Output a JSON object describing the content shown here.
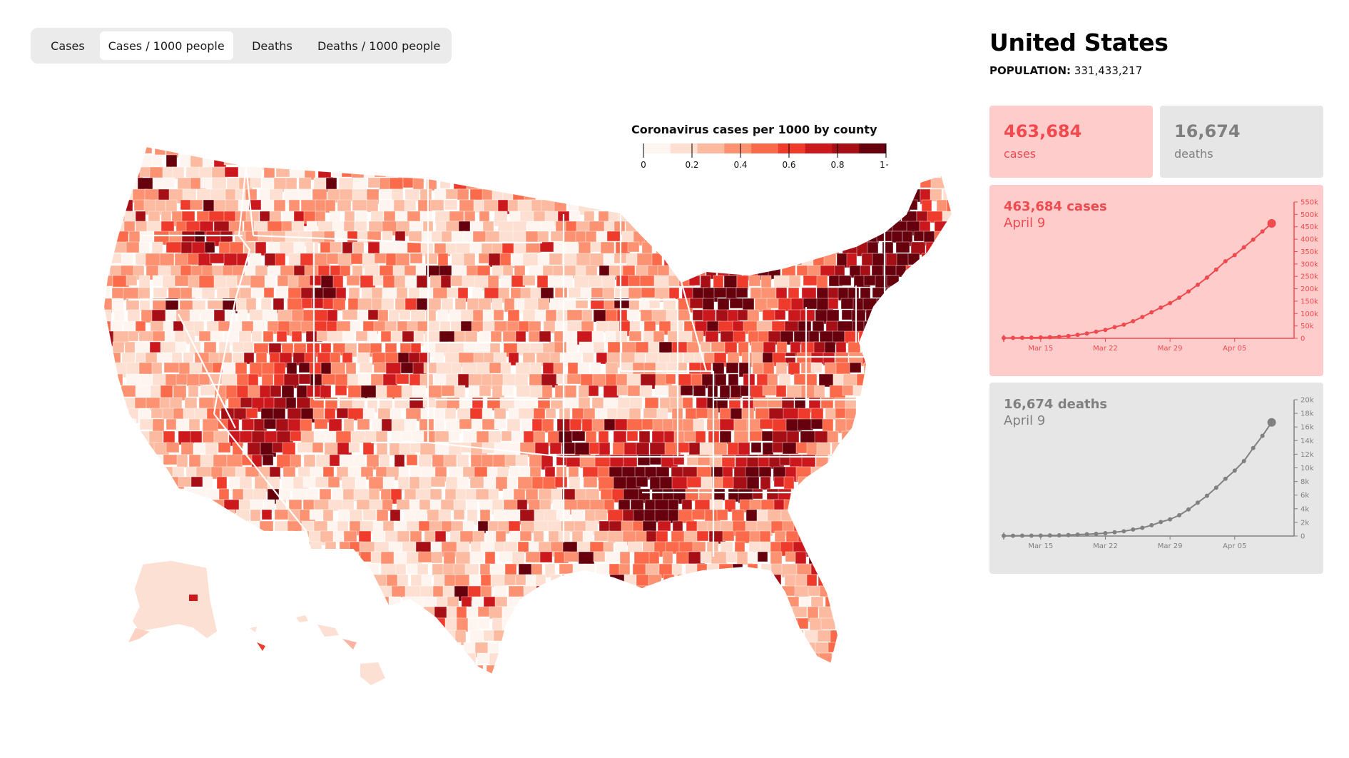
{
  "tabs": [
    {
      "label": "Cases",
      "active": false
    },
    {
      "label": "Cases / 1000 people",
      "active": true
    },
    {
      "label": "Deaths",
      "active": false
    },
    {
      "label": "Deaths / 1000 people",
      "active": false
    }
  ],
  "map": {
    "legend_title": "Coronavirus cases per 1000 by county",
    "legend_ticks": [
      "0",
      "0.2",
      "0.4",
      "0.6",
      "0.8",
      "1+"
    ],
    "color_scale": [
      "#fff5f0",
      "#fee0d2",
      "#fcbba1",
      "#fc9272",
      "#fb6a4a",
      "#ef3b2c",
      "#cb181d",
      "#a50f15",
      "#67000d"
    ]
  },
  "region": {
    "name": "United States",
    "population_label": "POPULATION:",
    "population_value": "331,433,217"
  },
  "summary": {
    "cases_value": "463,684",
    "cases_label": "cases",
    "deaths_value": "16,674",
    "deaths_label": "deaths"
  },
  "colors": {
    "cases_accent": "#f04a4f",
    "cases_bg": "#ffcccc",
    "deaths_accent": "#808080",
    "deaths_bg": "#e6e6e6"
  },
  "chart_data": [
    {
      "type": "line",
      "title": "463,684 cases",
      "subtitle": "April 9",
      "x_tick_labels": [
        "Mar 15",
        "Mar 22",
        "Mar 29",
        "Apr 05"
      ],
      "y_tick_labels": [
        "0",
        "50k",
        "100k",
        "150k",
        "200k",
        "250k",
        "300k",
        "350k",
        "400k",
        "450k",
        "500k",
        "550k"
      ],
      "ylim": [
        0,
        550000
      ],
      "x": [
        "Mar 11",
        "Mar 12",
        "Mar 13",
        "Mar 14",
        "Mar 15",
        "Mar 16",
        "Mar 17",
        "Mar 18",
        "Mar 19",
        "Mar 20",
        "Mar 21",
        "Mar 22",
        "Mar 23",
        "Mar 24",
        "Mar 25",
        "Mar 26",
        "Mar 27",
        "Mar 28",
        "Mar 29",
        "Mar 30",
        "Mar 31",
        "Apr 01",
        "Apr 02",
        "Apr 03",
        "Apr 04",
        "Apr 05",
        "Apr 06",
        "Apr 07",
        "Apr 08",
        "Apr 09"
      ],
      "values": [
        1300,
        1700,
        2200,
        2900,
        3500,
        4600,
        6400,
        9400,
        14000,
        19600,
        26700,
        34000,
        45000,
        55000,
        69000,
        86000,
        105000,
        124000,
        142000,
        164000,
        189000,
        216000,
        245000,
        277000,
        311000,
        336000,
        367000,
        398000,
        431000,
        463684
      ],
      "grid": false
    },
    {
      "type": "line",
      "title": "16,674 deaths",
      "subtitle": "April 9",
      "x_tick_labels": [
        "Mar 15",
        "Mar 22",
        "Mar 29",
        "Apr 05"
      ],
      "y_tick_labels": [
        "0",
        "2k",
        "4k",
        "6k",
        "8k",
        "10k",
        "12k",
        "14k",
        "16k",
        "18k",
        "20k"
      ],
      "ylim": [
        0,
        20000
      ],
      "x": [
        "Mar 11",
        "Mar 12",
        "Mar 13",
        "Mar 14",
        "Mar 15",
        "Mar 16",
        "Mar 17",
        "Mar 18",
        "Mar 19",
        "Mar 20",
        "Mar 21",
        "Mar 22",
        "Mar 23",
        "Mar 24",
        "Mar 25",
        "Mar 26",
        "Mar 27",
        "Mar 28",
        "Mar 29",
        "Mar 30",
        "Mar 31",
        "Apr 01",
        "Apr 02",
        "Apr 03",
        "Apr 04",
        "Apr 05",
        "Apr 06",
        "Apr 07",
        "Apr 08",
        "Apr 09"
      ],
      "values": [
        37,
        43,
        51,
        58,
        70,
        90,
        110,
        150,
        210,
        260,
        330,
        420,
        550,
        700,
        950,
        1200,
        1580,
        2050,
        2450,
        3050,
        3900,
        4900,
        5900,
        7100,
        8400,
        9600,
        11000,
        12900,
        14700,
        16674
      ],
      "grid": false
    }
  ]
}
